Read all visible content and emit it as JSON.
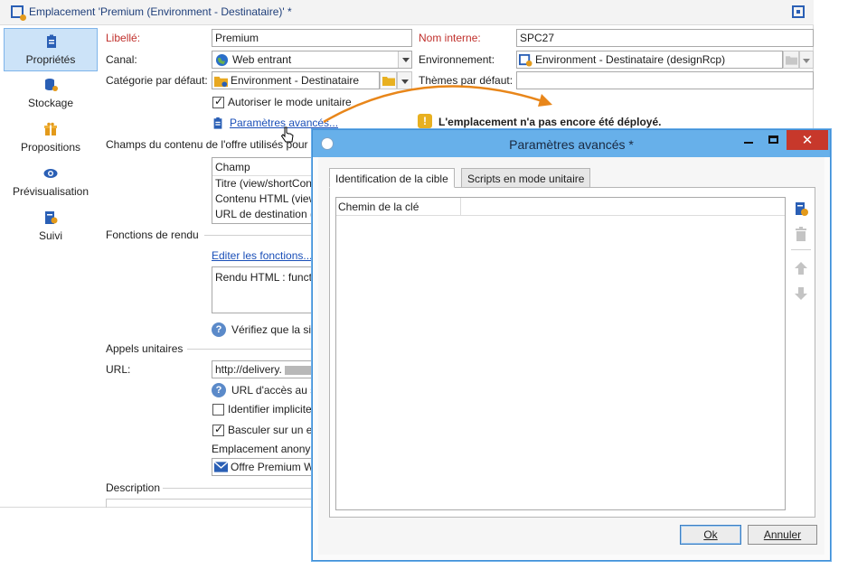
{
  "window": {
    "title": "Emplacement 'Premium  (Environment - Destinataire)' *"
  },
  "nav": [
    {
      "label": "Propriétés"
    },
    {
      "label": "Stockage"
    },
    {
      "label": "Propositions"
    },
    {
      "label": "Prévisualisation"
    },
    {
      "label": "Suivi"
    }
  ],
  "form": {
    "libelle_label": "Libellé:",
    "libelle_value": "Premium",
    "nom_interne_label": "Nom interne:",
    "nom_interne_value": "SPC27",
    "canal_label": "Canal:",
    "canal_value": "Web entrant",
    "environnement_label": "Environnement:",
    "environnement_value": "Environment - Destinataire (designRcp)",
    "categorie_label": "Catégorie par défaut:",
    "categorie_value": "Environment - Destinataire",
    "themes_label": "Thèmes par défaut:",
    "themes_value": "",
    "autoriser_label": "Autoriser le mode unitaire",
    "parametres_link": "Paramètres avancés...",
    "warning": "L'emplacement n'a pas encore été déployé.",
    "champs_section": "Champs du contenu de l'offre utilisés pour",
    "champs_header": "Champ",
    "champs_rows": [
      "Titre (view/shortCon",
      "Contenu HTML (view",
      "URL de destination ("
    ],
    "fonctions_section": "Fonctions de rendu",
    "editer_link": "Editer les fonctions...",
    "rendu_value": "Rendu HTML : functi",
    "verifiez_text": "Vérifiez que la sig",
    "appels_section": "Appels unitaires",
    "url_label": "URL:",
    "url_value": "http://delivery.",
    "url_help": "URL d'accès au se",
    "identifier_label": "Identifier implicite",
    "basculer_label": "Basculer sur un en",
    "emplacement_anonyme_label": "Emplacement anony",
    "emplacement_anonyme_value": "Offre Premium W",
    "description_section": "Description"
  },
  "dialog": {
    "title": "Paramètres avancés *",
    "tabs": [
      "Identification de la cible",
      "Scripts en mode unitaire"
    ],
    "grid_header": "Chemin de la clé",
    "ok_label": "Ok",
    "cancel_label": "Annuler"
  },
  "colors": {
    "accent": "#1a4fb8",
    "required": "#c0302c",
    "dialog_title": "#67b0ea",
    "close": "#c7382b",
    "callout_arrow": "#e8861a"
  }
}
